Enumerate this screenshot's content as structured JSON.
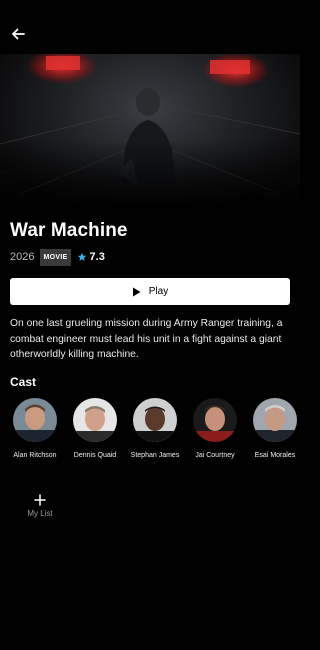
{
  "header": {
    "back_icon": "arrow-left-icon"
  },
  "movie": {
    "title": "War Machine",
    "year": "2026",
    "type_badge": "MOVIE",
    "rating": "7.3",
    "rating_icon": "star-icon",
    "rating_color": "#3ab0e0",
    "synopsis": "On one last grueling mission during Army Ranger training, a combat engineer must lead his unit in a fight against a giant otherworldly killing machine."
  },
  "actions": {
    "play_label": "Play",
    "play_icon": "play-icon",
    "mylist_label": "My List",
    "mylist_icon": "plus-icon"
  },
  "cast": {
    "heading": "Cast",
    "members": [
      {
        "name": "Alan Ritchson"
      },
      {
        "name": "Dennis Quaid"
      },
      {
        "name": "Stephan James"
      },
      {
        "name": "Jai Courtney"
      },
      {
        "name": "Esai Morales"
      }
    ]
  }
}
